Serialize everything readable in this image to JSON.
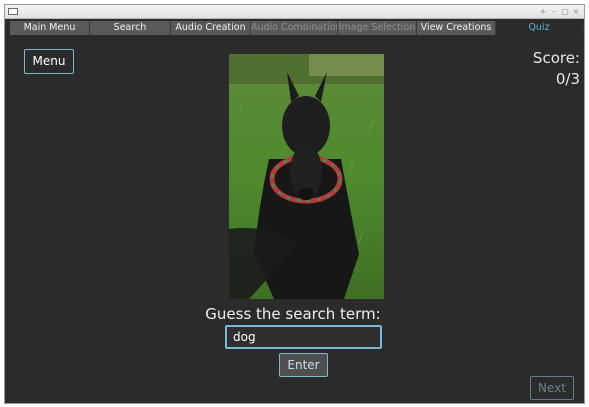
{
  "window": {
    "controls": [
      "+",
      "–",
      "□",
      "×"
    ]
  },
  "tabs": [
    {
      "label": "Main Menu",
      "state": "normal"
    },
    {
      "label": "Search",
      "state": "normal"
    },
    {
      "label": "Audio Creation",
      "state": "normal"
    },
    {
      "label": "Audio Combination",
      "state": "disabled"
    },
    {
      "label": "Image Selection",
      "state": "disabled"
    },
    {
      "label": "View Creations",
      "state": "normal"
    },
    {
      "label": "Quiz",
      "state": "active"
    }
  ],
  "menu_button": {
    "label": "Menu"
  },
  "score": {
    "label": "Score:",
    "value": "0/3"
  },
  "quiz_image": {
    "subject": "black schnauzer dog on grass wearing a red and green garland"
  },
  "prompt": {
    "text": "Guess the search term:"
  },
  "guess_input": {
    "value": "dog"
  },
  "enter_button": {
    "label": "Enter"
  },
  "next_button": {
    "label": "Next",
    "enabled": false
  },
  "colors": {
    "background": "#2b2b2b",
    "tab": "#5a5a5a",
    "accent": "#5ab4d8",
    "button_border": "#7fb8d0"
  }
}
